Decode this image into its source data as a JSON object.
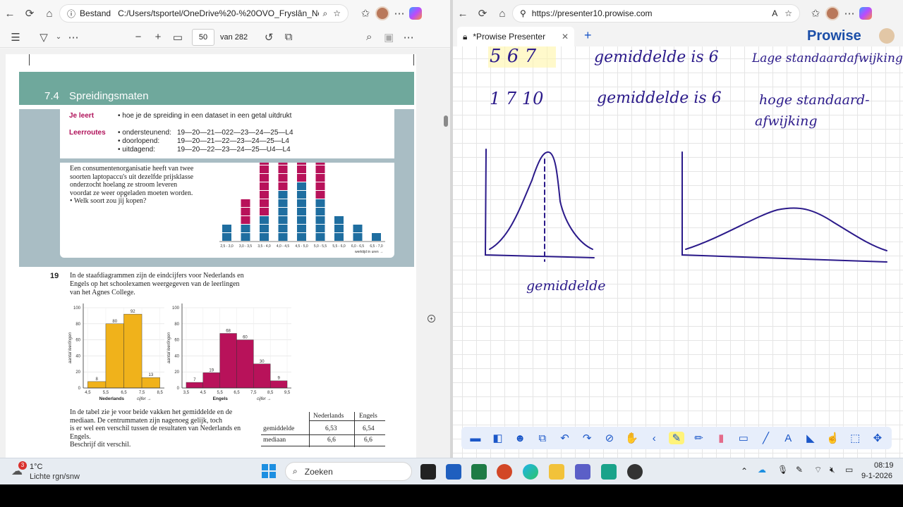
{
  "left_browser": {
    "security_label": "Bestand",
    "url": "C:/Users/tsportel/OneDrive%20-%20OVO_Fryslân_No...",
    "pdf": {
      "page_current": "50",
      "page_total": "van 282",
      "section_number": "7.4",
      "section_title": "Spreidingsmaten",
      "je_leert_label": "Je leert",
      "je_leert_text": "• hoe je de spreiding in een dataset in een getal uitdrukt",
      "leerroutes_label": "Leerroutes",
      "routes": [
        {
          "name": "• ondersteunend:",
          "path": "19—20—21—022—23—24—25—L4"
        },
        {
          "name": "• doorlopend:",
          "path": "19—20—21—22—23—24—25—L4"
        },
        {
          "name": "• uitdagend:",
          "path": "19—20—22—23—24—25—U4—L4"
        }
      ],
      "intro_lines": [
        "Een consumentenorganisatie heeft van twee",
        "soorten laptopaccu's uit dezelfde prijsklasse",
        "onderzocht hoelang ze stroom leveren",
        "voordat ze weer opgeladen moeten worden.",
        "• Welk soort zou jij kopen?"
      ],
      "q19_number": "19",
      "q19_lines": [
        "In de staafdiagrammen zijn de eindcijfers voor Nederlands en",
        "Engels op het schoolexamen weergegeven van de leerlingen",
        "van het Agnes College."
      ],
      "bottom_lines": [
        "In de tabel zie je voor beide vakken het gemiddelde en de",
        "mediaan. De centrummaten zijn nagenoeg gelijk, toch",
        "is er wel een verschil tussen de resultaten van Nederlands en",
        "Engels.",
        "Beschrijf dit verschil."
      ],
      "table": {
        "headers": [
          "Nederlands",
          "Engels"
        ],
        "rows": [
          {
            "label": "gemiddelde",
            "values": [
              "6,53",
              "6,54"
            ]
          },
          {
            "label": "mediaan",
            "values": [
              "6,6",
              "6,6"
            ]
          }
        ]
      }
    }
  },
  "chart_data": [
    {
      "type": "bar",
      "categories": [
        "2,5 - 3,0",
        "3,0 - 3,5",
        "3,5 - 4,0",
        "4,0 - 4,5",
        "4,5 - 5,0",
        "5,0 - 5,5",
        "5,5 - 6,0",
        "6,0 - 6,5",
        "6,5 - 7,0"
      ],
      "series": [
        {
          "values": [
            2,
            2,
            3,
            6,
            7,
            5,
            3,
            2,
            1
          ]
        },
        {
          "values": [
            0,
            3,
            9,
            11,
            7,
            5,
            0,
            0,
            0
          ]
        }
      ],
      "xlabel": "werktijd in uren →",
      "colors": [
        "#1f6ea0",
        "#b8125a"
      ]
    },
    {
      "type": "bar",
      "categories": [
        "4,5 - 5,5",
        "5,5 - 6,5",
        "6,5 - 7,5",
        "7,5 - 8,5"
      ],
      "values": [
        8,
        80,
        92,
        13
      ],
      "title": "Nederlands",
      "xlabel": "cijfer →",
      "ylabel": "aantal leerlingen",
      "ylim": [
        0,
        100
      ],
      "xticks": [
        "4,5",
        "5,5",
        "6,5",
        "7,5",
        "8,5"
      ],
      "yticks": [
        "0",
        "20",
        "40",
        "60",
        "80",
        "100"
      ],
      "color": "#f0b21b"
    },
    {
      "type": "bar",
      "categories": [
        "3,5 - 4,5",
        "4,5 - 5,5",
        "5,5 - 6,5",
        "6,5 - 7,5",
        "7,5 - 8,5",
        "8,5 - 9,5"
      ],
      "values": [
        7,
        19,
        68,
        60,
        30,
        9
      ],
      "title": "Engels",
      "xlabel": "cijfer →",
      "ylabel": "aantal leerlingen",
      "ylim": [
        0,
        100
      ],
      "xticks": [
        "3,5",
        "4,5",
        "5,5",
        "6,5",
        "7,5",
        "8,5",
        "9,5"
      ],
      "yticks": [
        "0",
        "20",
        "40",
        "60",
        "80",
        "100"
      ],
      "color": "#b8125a"
    }
  ],
  "right_browser": {
    "url": "https://presenter10.prowise.com",
    "tab_title": "*Prowise Presenter",
    "brand": "Prowise",
    "handwriting": {
      "row1_numbers": "5 6 7",
      "row1_text": "gemiddelde is 6",
      "row1_note": "Lage standaardafwijking",
      "row2_numbers": "1 7 10",
      "row2_text": "gemiddelde is 6",
      "row2_note_1": "hoge standaard-",
      "row2_note_2": "afwijking",
      "curve_label": "gemiddelde"
    }
  },
  "taskbar": {
    "weather_badge": "3",
    "temperature": "1°C",
    "weather_desc": "Lichte rgn/snw",
    "search_placeholder": "Zoeken",
    "time": "08:19",
    "date": "9-1-2026"
  }
}
